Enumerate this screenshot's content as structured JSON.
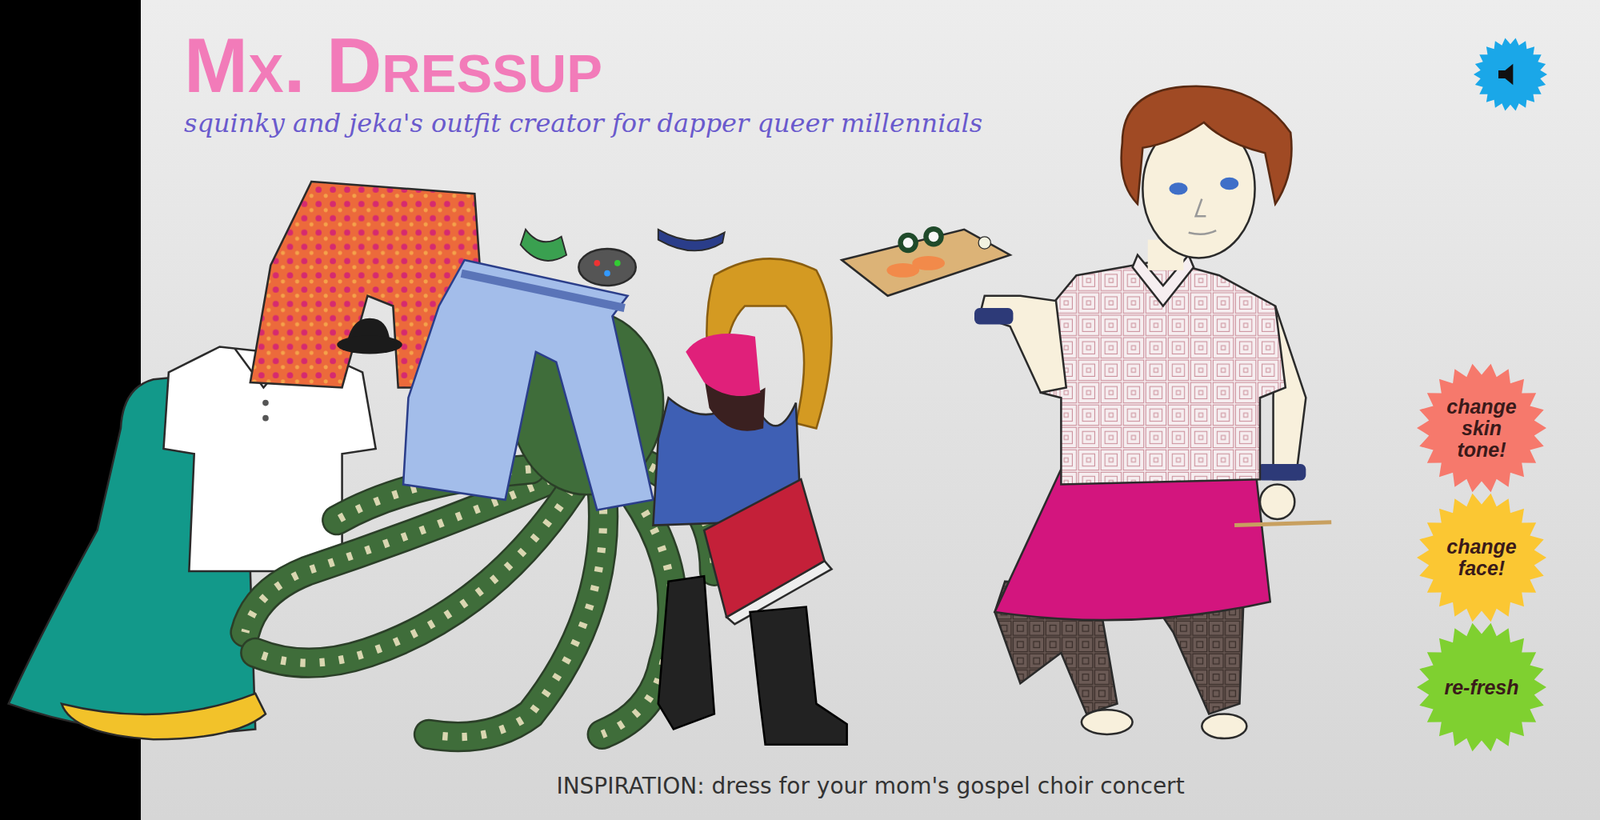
{
  "header": {
    "title": "Mx. Dressup",
    "subtitle": "squinky and jeka's outfit creator for dapper queer millennials"
  },
  "buttons": [
    {
      "label": "change skin tone!",
      "color": "#f6796c"
    },
    {
      "label": "change face!",
      "color": "#fbc733"
    },
    {
      "label": "re-fresh",
      "color": "#7fd030"
    }
  ],
  "inspiration": "INSPIRATION: dress for your mom's gospel choir concert"
}
